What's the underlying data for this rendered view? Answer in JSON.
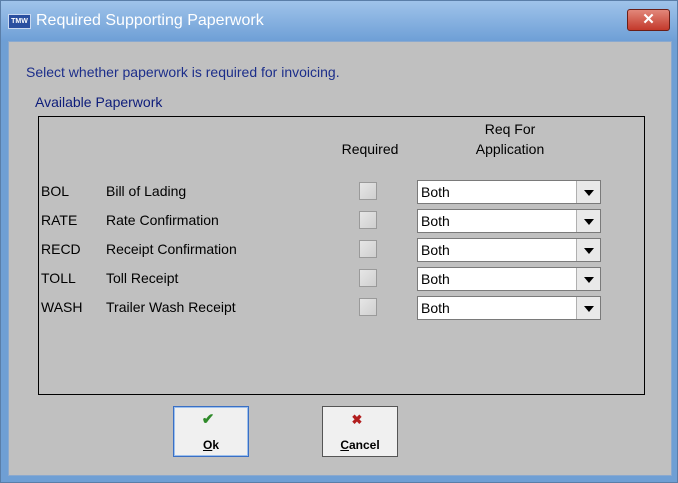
{
  "window": {
    "title": "Required Supporting Paperwork",
    "app_icon_text": "TMW",
    "close_glyph": "✕"
  },
  "instruction": "Select whether paperwork is required for invoicing.",
  "group": {
    "title": "Available Paperwork",
    "headers": {
      "required": "Required",
      "req_for_line1": "Req For",
      "req_for_line2": "Application"
    },
    "rows": [
      {
        "code": "BOL",
        "description": "Bill of Lading",
        "required": false,
        "application": "Both"
      },
      {
        "code": "RATE",
        "description": "Rate Confirmation",
        "required": false,
        "application": "Both"
      },
      {
        "code": "RECD",
        "description": "Receipt Confirmation",
        "required": false,
        "application": "Both"
      },
      {
        "code": "TOLL",
        "description": "Toll Receipt",
        "required": false,
        "application": "Both"
      },
      {
        "code": "WASH",
        "description": "Trailer Wash Receipt",
        "required": false,
        "application": "Both"
      }
    ]
  },
  "buttons": {
    "ok": {
      "first": "O",
      "rest": "k",
      "icon": "✔"
    },
    "cancel": {
      "first": "C",
      "rest": "ancel",
      "icon": "✖"
    }
  },
  "icons": {
    "ok": "check-icon",
    "cancel": "x-icon",
    "dropdown": "chevron-down-icon"
  }
}
